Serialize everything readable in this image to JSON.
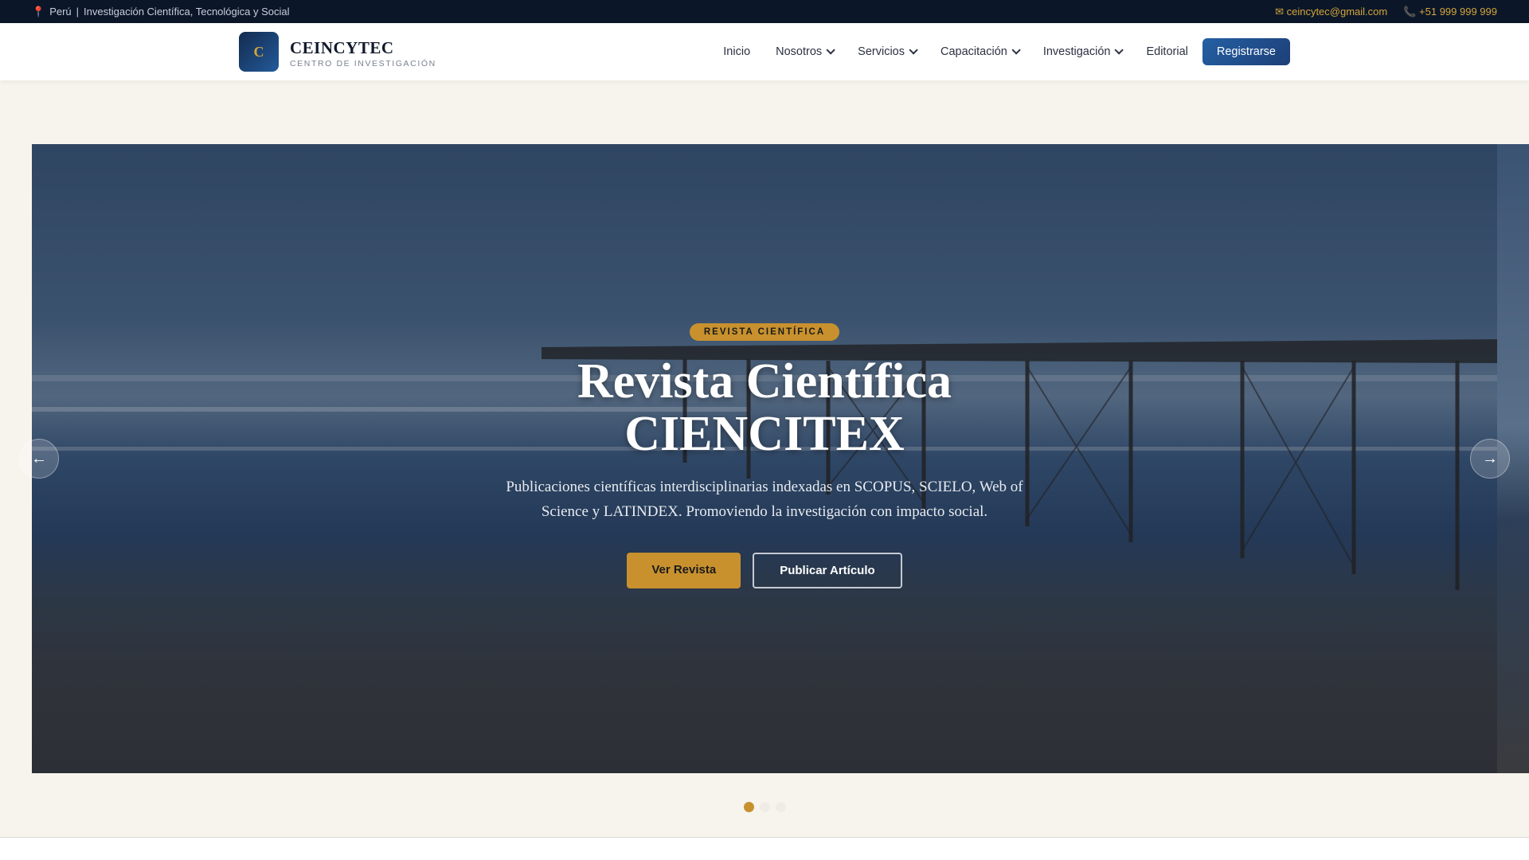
{
  "topbar": {
    "location_icon": "pin-icon",
    "location": "Perú",
    "separator": "|",
    "tagline": "Investigación Científica, Tecnológica y Social",
    "email_icon": "envelope-icon",
    "email": "ceincytec@gmail.com",
    "phone_icon": "phone-icon",
    "phone": "+51 999 999 999"
  },
  "brand": {
    "logo_letter": "C",
    "name": "CEINCYTEC",
    "subtitle": "CENTRO DE INVESTIGACIÓN"
  },
  "nav": {
    "items": [
      {
        "label": "Inicio"
      },
      {
        "label": "Nosotros"
      },
      {
        "label": "Servicios"
      },
      {
        "label": "Capacitación"
      },
      {
        "label": "Investigación"
      },
      {
        "label": "Editorial"
      }
    ],
    "register": "Registrarse"
  },
  "hero": {
    "badge": "REVISTA CIENTÍFICA",
    "title_line1": "Revista Científica",
    "title_line2": "CIENCITEX",
    "description": "Publicaciones científicas interdisciplinarias indexadas en SCOPUS, SCIELO, Web of Science y LATINDEX. Promoviendo la investigación con impacto social.",
    "primary_button": "Ver Revista",
    "secondary_button": "Publicar Artículo",
    "prev": "←",
    "next": "→",
    "slide_count": 3,
    "active_slide": 1
  },
  "colors": {
    "accent": "#c8912e",
    "navy": "#0b1629",
    "primary": "#2460a3"
  }
}
